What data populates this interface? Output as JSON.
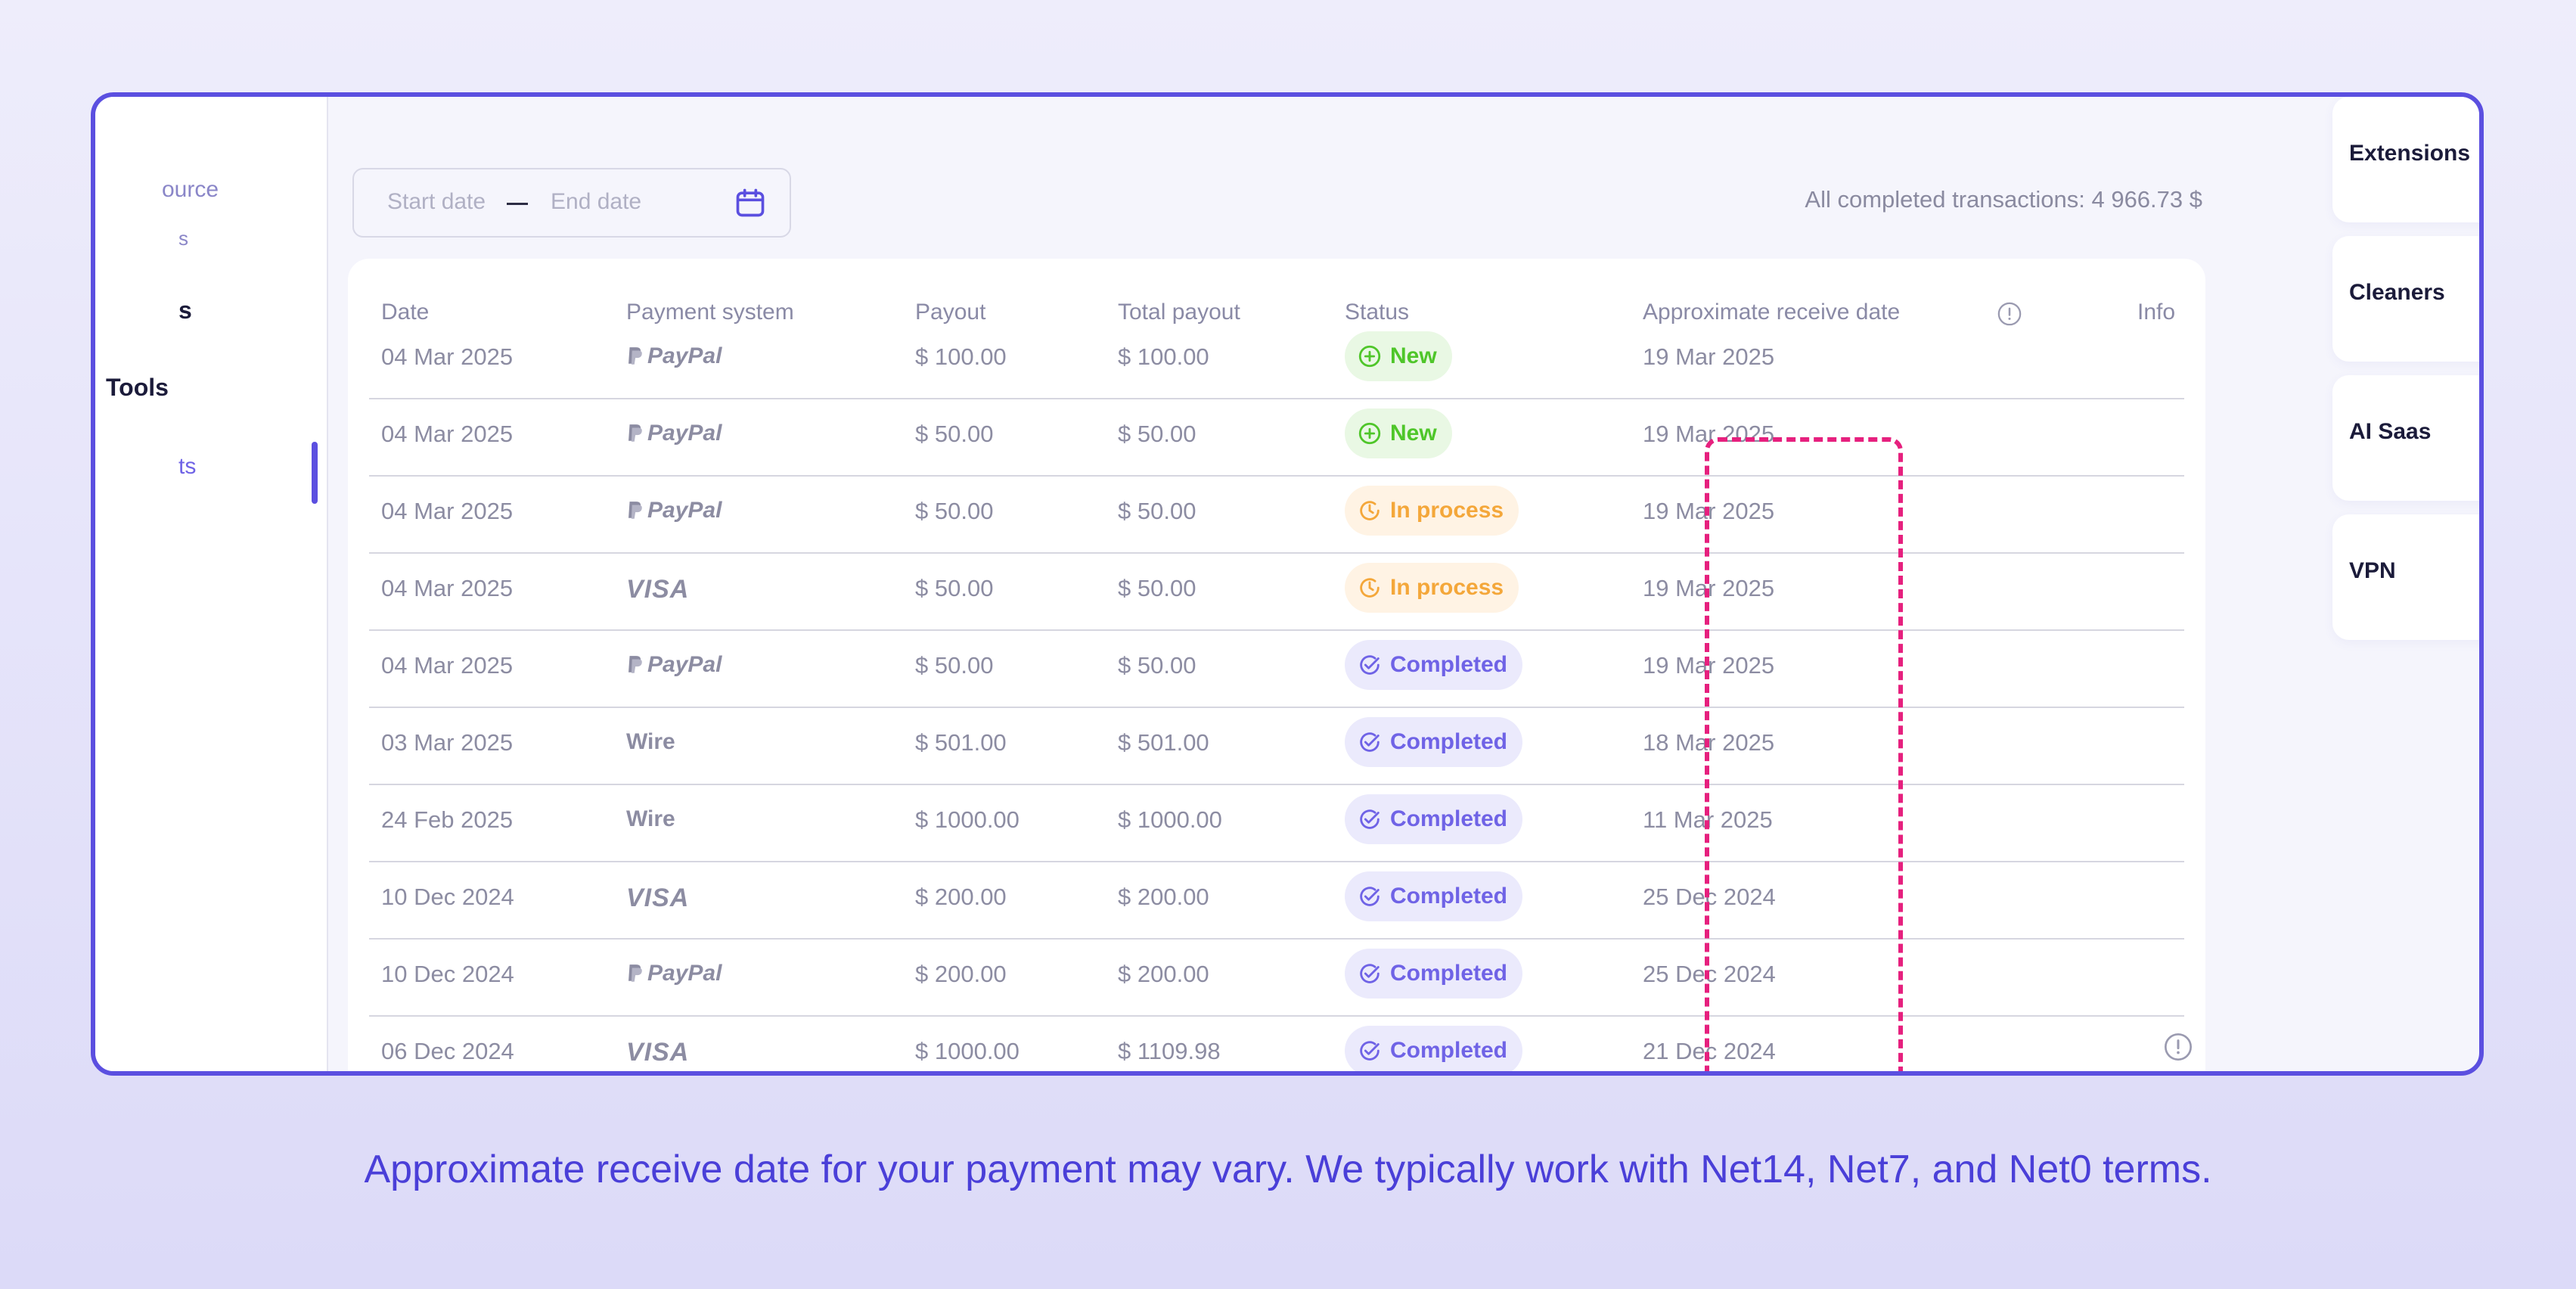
{
  "sidebar": {
    "items": [
      {
        "label": "ource"
      },
      {
        "label": "s"
      },
      {
        "label": "s"
      },
      {
        "label": "Tools"
      },
      {
        "label": "ts"
      }
    ]
  },
  "filter": {
    "start_placeholder": "Start date",
    "end_placeholder": "End date"
  },
  "summary": {
    "total": "All completed transactions: 4 966.73 $"
  },
  "table": {
    "headers": [
      "Date",
      "Payment system",
      "Payout",
      "Total payout",
      "Status",
      "Approximate receive date",
      "Info"
    ],
    "rows": [
      {
        "date": "04 Mar 2025",
        "system": "PayPal",
        "payout": "$ 100.00",
        "total": "$ 100.00",
        "status": "New",
        "receive": "19 Mar 2025"
      },
      {
        "date": "04 Mar 2025",
        "system": "PayPal",
        "payout": "$ 50.00",
        "total": "$ 50.00",
        "status": "New",
        "receive": "19 Mar 2025"
      },
      {
        "date": "04 Mar 2025",
        "system": "PayPal",
        "payout": "$ 50.00",
        "total": "$ 50.00",
        "status": "In process",
        "receive": "19 Mar 2025"
      },
      {
        "date": "04 Mar 2025",
        "system": "VISA",
        "payout": "$ 50.00",
        "total": "$ 50.00",
        "status": "In process",
        "receive": "19 Mar 2025"
      },
      {
        "date": "04 Mar 2025",
        "system": "PayPal",
        "payout": "$ 50.00",
        "total": "$ 50.00",
        "status": "Completed",
        "receive": "19 Mar 2025"
      },
      {
        "date": "03 Mar 2025",
        "system": "Wire",
        "payout": "$ 501.00",
        "total": "$ 501.00",
        "status": "Completed",
        "receive": "18 Mar 2025"
      },
      {
        "date": "24 Feb 2025",
        "system": "Wire",
        "payout": "$ 1000.00",
        "total": "$ 1000.00",
        "status": "Completed",
        "receive": "11 Mar 2025"
      },
      {
        "date": "10 Dec 2024",
        "system": "VISA",
        "payout": "$ 200.00",
        "total": "$ 200.00",
        "status": "Completed",
        "receive": "25 Dec 2024"
      },
      {
        "date": "10 Dec 2024",
        "system": "PayPal",
        "payout": "$ 200.00",
        "total": "$ 200.00",
        "status": "Completed",
        "receive": "25 Dec 2024"
      },
      {
        "date": "06 Dec 2024",
        "system": "VISA",
        "payout": "$ 1000.00",
        "total": "$ 1109.98",
        "status": "Completed",
        "receive": "21 Dec 2024"
      }
    ]
  },
  "categories": [
    {
      "label": "Extensions"
    },
    {
      "label": "Cleaners"
    },
    {
      "label": "AI Saas"
    },
    {
      "label": "VPN"
    }
  ],
  "caption": "Approximate receive date for your payment may vary. We typically work with Net14, Net7, and Net0 terms.",
  "colors": {
    "accent": "#5b4fe0",
    "highlight": "#e6207e",
    "status_new": "#4fc62a",
    "status_in_process": "#f4a73a",
    "status_completed": "#6f63e6"
  },
  "icons": {
    "calendar": "calendar-icon",
    "info": "info-icon",
    "new": "plus-circle-icon",
    "in_process": "clock-icon",
    "completed": "check-circle-icon"
  }
}
